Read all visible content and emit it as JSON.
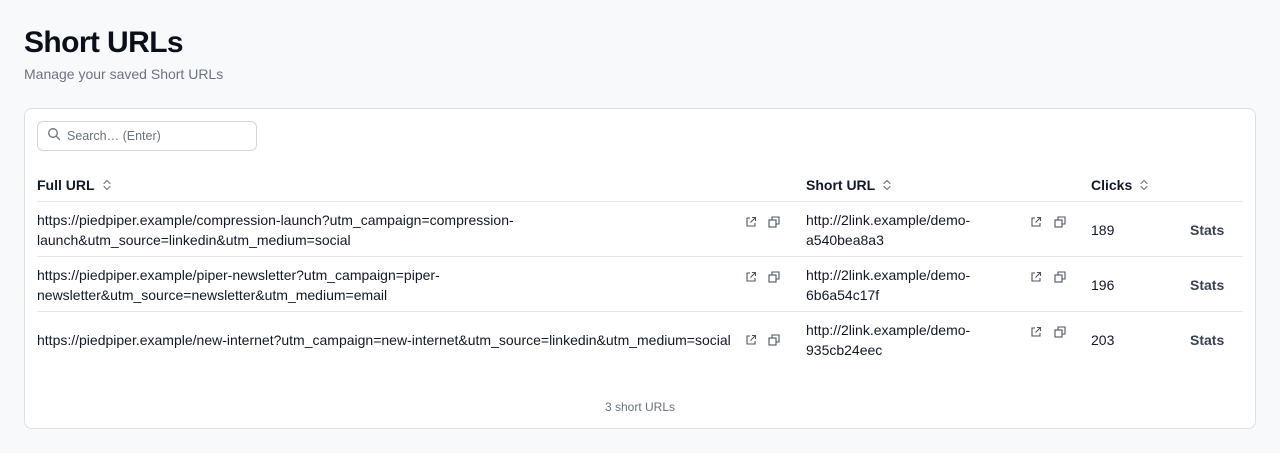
{
  "header": {
    "title": "Short URLs",
    "subtitle": "Manage your saved Short URLs"
  },
  "search": {
    "placeholder": "Search… (Enter)",
    "value": ""
  },
  "table": {
    "columns": {
      "full_url": "Full URL",
      "short_url": "Short URL",
      "clicks": "Clicks"
    },
    "rows": [
      {
        "full_url_line1": "https://piedpiper.example/compression-launch?utm_campaign=compression-",
        "full_url_line2": "launch&utm_source=linkedin&utm_medium=social",
        "short_url_line1": "http://2link.example/demo-",
        "short_url_line2": "a540bea8a3",
        "clicks": "189",
        "stats_label": "Stats"
      },
      {
        "full_url_line1": "https://piedpiper.example/piper-newsletter?utm_campaign=piper-",
        "full_url_line2": "newsletter&utm_source=newsletter&utm_medium=email",
        "short_url_line1": "http://2link.example/demo-",
        "short_url_line2": "6b6a54c17f",
        "clicks": "196",
        "stats_label": "Stats"
      },
      {
        "full_url_line1": "https://piedpiper.example/new-internet?utm_campaign=new-internet&utm_source=linkedin&utm_medium=social",
        "full_url_line2": "",
        "short_url_line1": "http://2link.example/demo-",
        "short_url_line2": "935cb24eec",
        "clicks": "203",
        "stats_label": "Stats"
      }
    ]
  },
  "footer": {
    "count_text": "3 short URLs"
  },
  "icons": {
    "search": "search-icon",
    "sort": "sort-icon",
    "open": "external-link-icon",
    "copy": "copy-icon"
  },
  "colors": {
    "background": "#f8f9fb",
    "card": "#ffffff",
    "border": "#dcdfe4",
    "muted_text": "#6b7280"
  }
}
